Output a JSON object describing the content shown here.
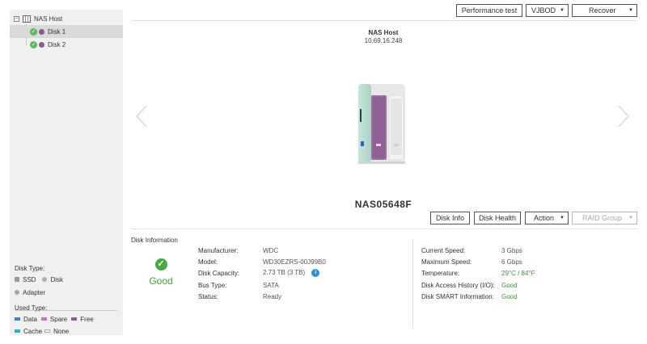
{
  "sidebar": {
    "root_label": "NAS Host",
    "disks": [
      {
        "label": "Disk 1",
        "selected": true
      },
      {
        "label": "Disk 2",
        "selected": false
      }
    ],
    "disk_type_title": "Disk Type:",
    "disk_types": [
      "SSD",
      "Disk",
      "Adapter"
    ],
    "used_type_title": "Used Type:",
    "used_types": [
      "Data",
      "Spare",
      "Free",
      "Cache",
      "None"
    ]
  },
  "toolbar": {
    "performance_test": "Performance test",
    "vjbod": "VJBOD",
    "recover": "Recover"
  },
  "host": {
    "name": "NAS Host",
    "ip": "10.69.16.248",
    "model": "NAS05648F"
  },
  "disk_actions": {
    "disk_info": "Disk Info",
    "disk_health": "Disk Health",
    "action": "Action",
    "raid_group": "RAID Group"
  },
  "disk_information": {
    "title": "Disk Information",
    "status_text": "Good",
    "left": [
      {
        "label": "Manufacturer:",
        "value": "WDC"
      },
      {
        "label": "Model:",
        "value": "WD30EZRS-00J99B0"
      },
      {
        "label": "Disk Capacity:",
        "value": "2.73 TB (3 TB)"
      },
      {
        "label": "Bus Type:",
        "value": "SATA"
      },
      {
        "label": "Status:",
        "value": "Ready"
      }
    ],
    "right": [
      {
        "label": "Current Speed:",
        "value": "3 Gbps"
      },
      {
        "label": "Maximum Speed:",
        "value": "6 Gbps"
      },
      {
        "label": "Temperature:",
        "value": "29°C / 84°F"
      },
      {
        "label": "Disk Access History (I/O):",
        "value": "Good"
      },
      {
        "label": "Disk SMART Information:",
        "value": "Good"
      }
    ]
  },
  "colors": {
    "ssd": "#9a9a9a",
    "disk": "#b0b0b0",
    "adapter": "#a8a8a8",
    "data": "#3d7fe0",
    "spare": "#d46ad4",
    "free": "#8a5a9a",
    "cache": "#2ab0c8",
    "good": "#3ea03e",
    "info": "#2f8fdc"
  }
}
